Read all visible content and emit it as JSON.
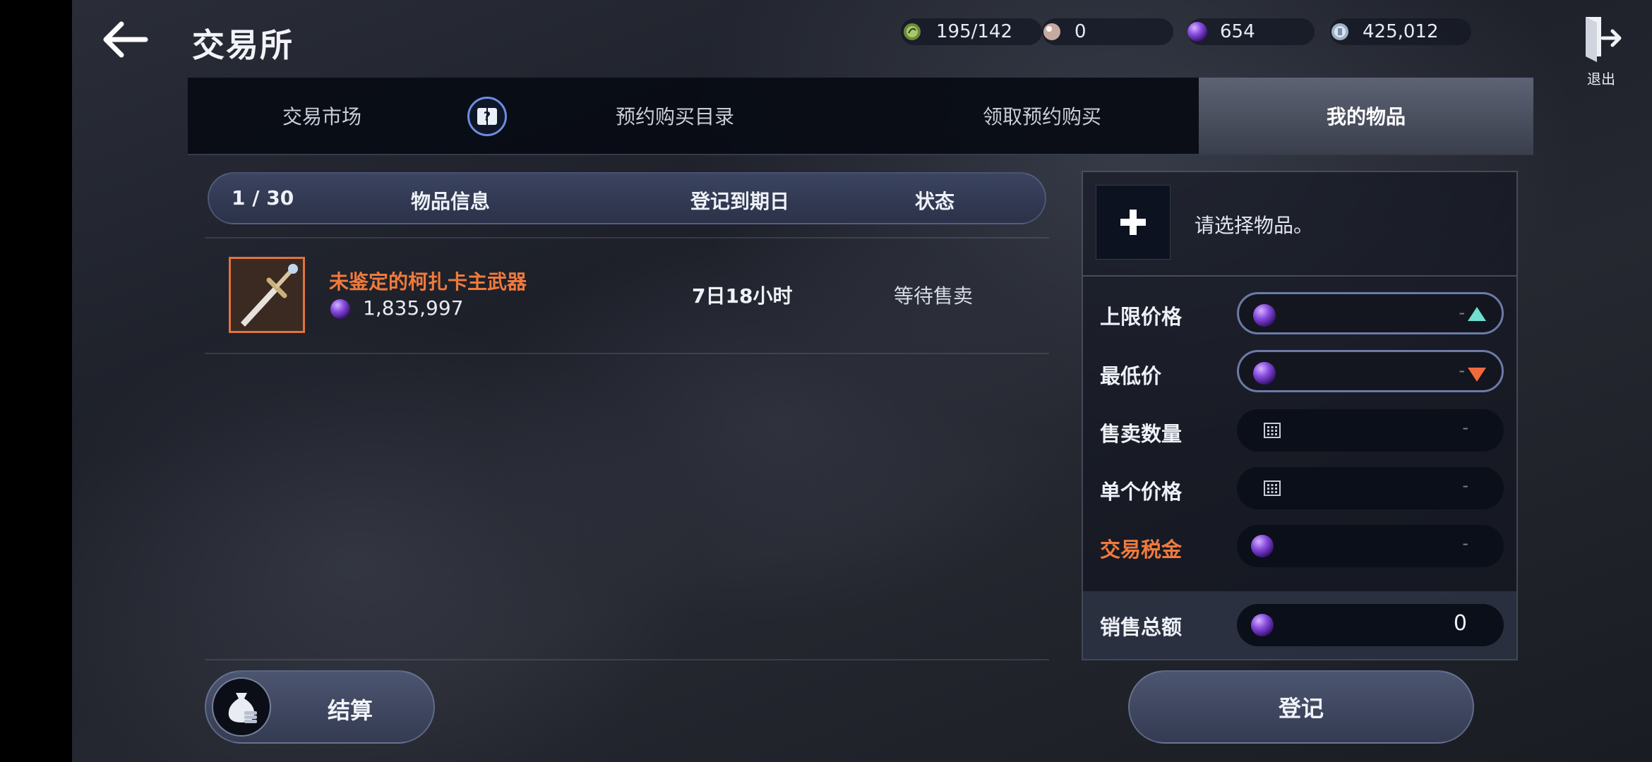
{
  "header": {
    "title": "交易所",
    "exit_label": "退出"
  },
  "currencies": [
    {
      "icon": "leaf-energy-icon",
      "value": "195/142"
    },
    {
      "icon": "pearl-icon",
      "value": "0"
    },
    {
      "icon": "purple-gem-icon",
      "value": "654"
    },
    {
      "icon": "silver-coin-icon",
      "value": "425,012"
    }
  ],
  "tabs": [
    {
      "label": "交易市场"
    },
    {
      "label": "预约购买目录"
    },
    {
      "label": "领取预约购买"
    },
    {
      "label": "我的物品"
    }
  ],
  "list": {
    "count": "1 / 30",
    "col_info": "物品信息",
    "col_expiry": "登记到期日",
    "col_status": "状态",
    "items": [
      {
        "name": "未鉴定的柯扎卡主武器",
        "price": "1,835,997",
        "expiry": "7日18小时",
        "status": "等待售卖"
      }
    ]
  },
  "panel": {
    "select_hint": "请选择物品。",
    "max_price_label": "上限价格",
    "min_price_label": "最低价",
    "quantity_label": "售卖数量",
    "unit_price_label": "单个价格",
    "tax_label": "交易税金",
    "total_label": "销售总额",
    "placeholder_dash": "-",
    "total_value": "0"
  },
  "buttons": {
    "settle": "结算",
    "register": "登记"
  },
  "colors": {
    "accent_orange": "#f07a3c",
    "teal_up": "#6fe0cf",
    "orange_down": "#f06a3c"
  }
}
